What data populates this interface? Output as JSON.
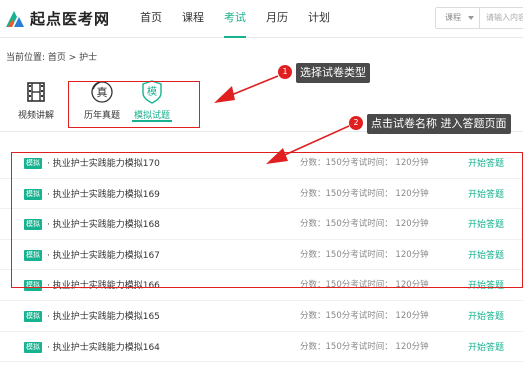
{
  "header": {
    "logo_text": "起点医考网",
    "nav": [
      "首页",
      "课程",
      "考试",
      "月历",
      "计划"
    ],
    "active_nav": "考试",
    "search_select": "课程",
    "search_placeholder": "请输入内容"
  },
  "breadcrumb": "当前位置: 首页 > 护士",
  "tabs": [
    {
      "label": "视频讲解",
      "icon": "film-icon"
    },
    {
      "label": "历年真题",
      "icon": "real-exam-icon",
      "icon_char": "真"
    },
    {
      "label": "模拟试题",
      "icon": "mock-exam-icon",
      "icon_char": "模"
    }
  ],
  "active_tab": "模拟试题",
  "annotations": {
    "badge1": "1",
    "tip1": "选择试卷类型",
    "badge2": "2",
    "tip2": "点击试卷名称 进入答题页面"
  },
  "exam_rows": [
    {
      "tag": "模拟",
      "name": "· 执业护士实践能力模拟170",
      "info": "分数：150分考试时间： 120分钟",
      "action": "开始答题"
    },
    {
      "tag": "模拟",
      "name": "· 执业护士实践能力模拟169",
      "info": "分数：150分考试时间： 120分钟",
      "action": "开始答题"
    },
    {
      "tag": "模拟",
      "name": "· 执业护士实践能力模拟168",
      "info": "分数：150分考试时间： 120分钟",
      "action": "开始答题"
    },
    {
      "tag": "模拟",
      "name": "· 执业护士实践能力模拟167",
      "info": "分数：150分考试时间： 120分钟",
      "action": "开始答题"
    },
    {
      "tag": "模拟",
      "name": "· 执业护士实践能力模拟166",
      "info": "分数：150分考试时间： 120分钟",
      "action": "开始答题"
    },
    {
      "tag": "模拟",
      "name": "· 执业护士实践能力模拟165",
      "info": "分数：150分考试时间： 120分钟",
      "action": "开始答题"
    },
    {
      "tag": "模拟",
      "name": "· 执业护士实践能力模拟164",
      "info": "分数：150分考试时间： 120分钟",
      "action": "开始答题"
    }
  ],
  "colors": {
    "accent": "#17b28f",
    "annotation": "#e02020",
    "tooltip": "#4a4a4a"
  }
}
